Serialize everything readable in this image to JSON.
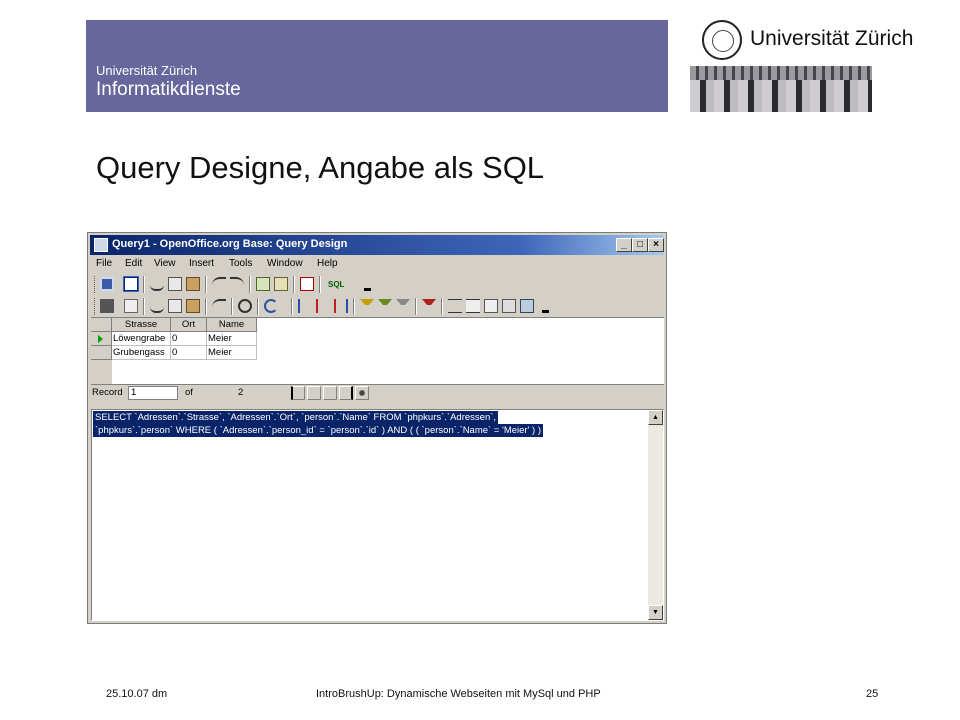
{
  "slide": {
    "header_sub": "Universität Zürich",
    "header_title": "Informatikdienste",
    "logo_text": "Universität Zürich",
    "title": "Query Designe, Angabe als SQL",
    "footer_left": "25.10.07 dm",
    "footer_center": "IntroBrushUp: Dynamische Webseiten mit MySql und PHP",
    "footer_right": "25"
  },
  "window": {
    "title": "Query1 - OpenOffice.org Base: Query Design",
    "controls": {
      "minimize": "_",
      "maximize": "□",
      "close": "×"
    },
    "menu": [
      "File",
      "Edit",
      "View",
      "Insert",
      "Tools",
      "Window",
      "Help"
    ]
  },
  "toolbar1": {
    "icons": [
      "save-icon",
      "edit-icon",
      "cut-icon",
      "copy-icon",
      "paste-icon",
      "undo-icon",
      "redo-icon",
      "design-view-icon",
      "table-icon",
      "delete-icon",
      "sql-icon"
    ],
    "sql_label": "SQL"
  },
  "toolbar2": {
    "icons": [
      "save-record-icon",
      "edit-data-icon",
      "cut-icon",
      "copy-icon",
      "paste-icon",
      "undo-icon",
      "find-icon",
      "refresh-icon",
      "sort-ascending-icon",
      "sort-descending-icon",
      "autofilter-icon",
      "apply-filter-icon",
      "standard-filter-icon",
      "remove-filter-icon",
      "data-to-text-icon",
      "data-to-fields-icon",
      "mail-merge-icon",
      "report-icon",
      "data-source-icon"
    ]
  },
  "grid": {
    "columns": [
      "Strasse",
      "Ort",
      "Name"
    ],
    "rows": [
      [
        "Löwengrabe",
        "0",
        "Meier"
      ],
      [
        "Grubengass",
        "0",
        "Meier"
      ]
    ]
  },
  "navigation": {
    "record_label": "Record",
    "current": "1",
    "of_label": "of",
    "total": "2"
  },
  "sql": {
    "lines": [
      "SELECT `Adressen`.`Strasse`, `Adressen`.`Ort`, `person`.`Name` FROM `phpkurs`.`Adressen`,",
      "`phpkurs`.`person` WHERE ( `Adressen`.`person_id` = `person`.`id` ) AND ( ( `person`.`Name` = 'Meier' ) )"
    ]
  },
  "colors": {
    "header_band": "#67679e",
    "titlebar": "#0a246a",
    "selection": "#0a246a",
    "window_face": "#d4d0c8"
  }
}
